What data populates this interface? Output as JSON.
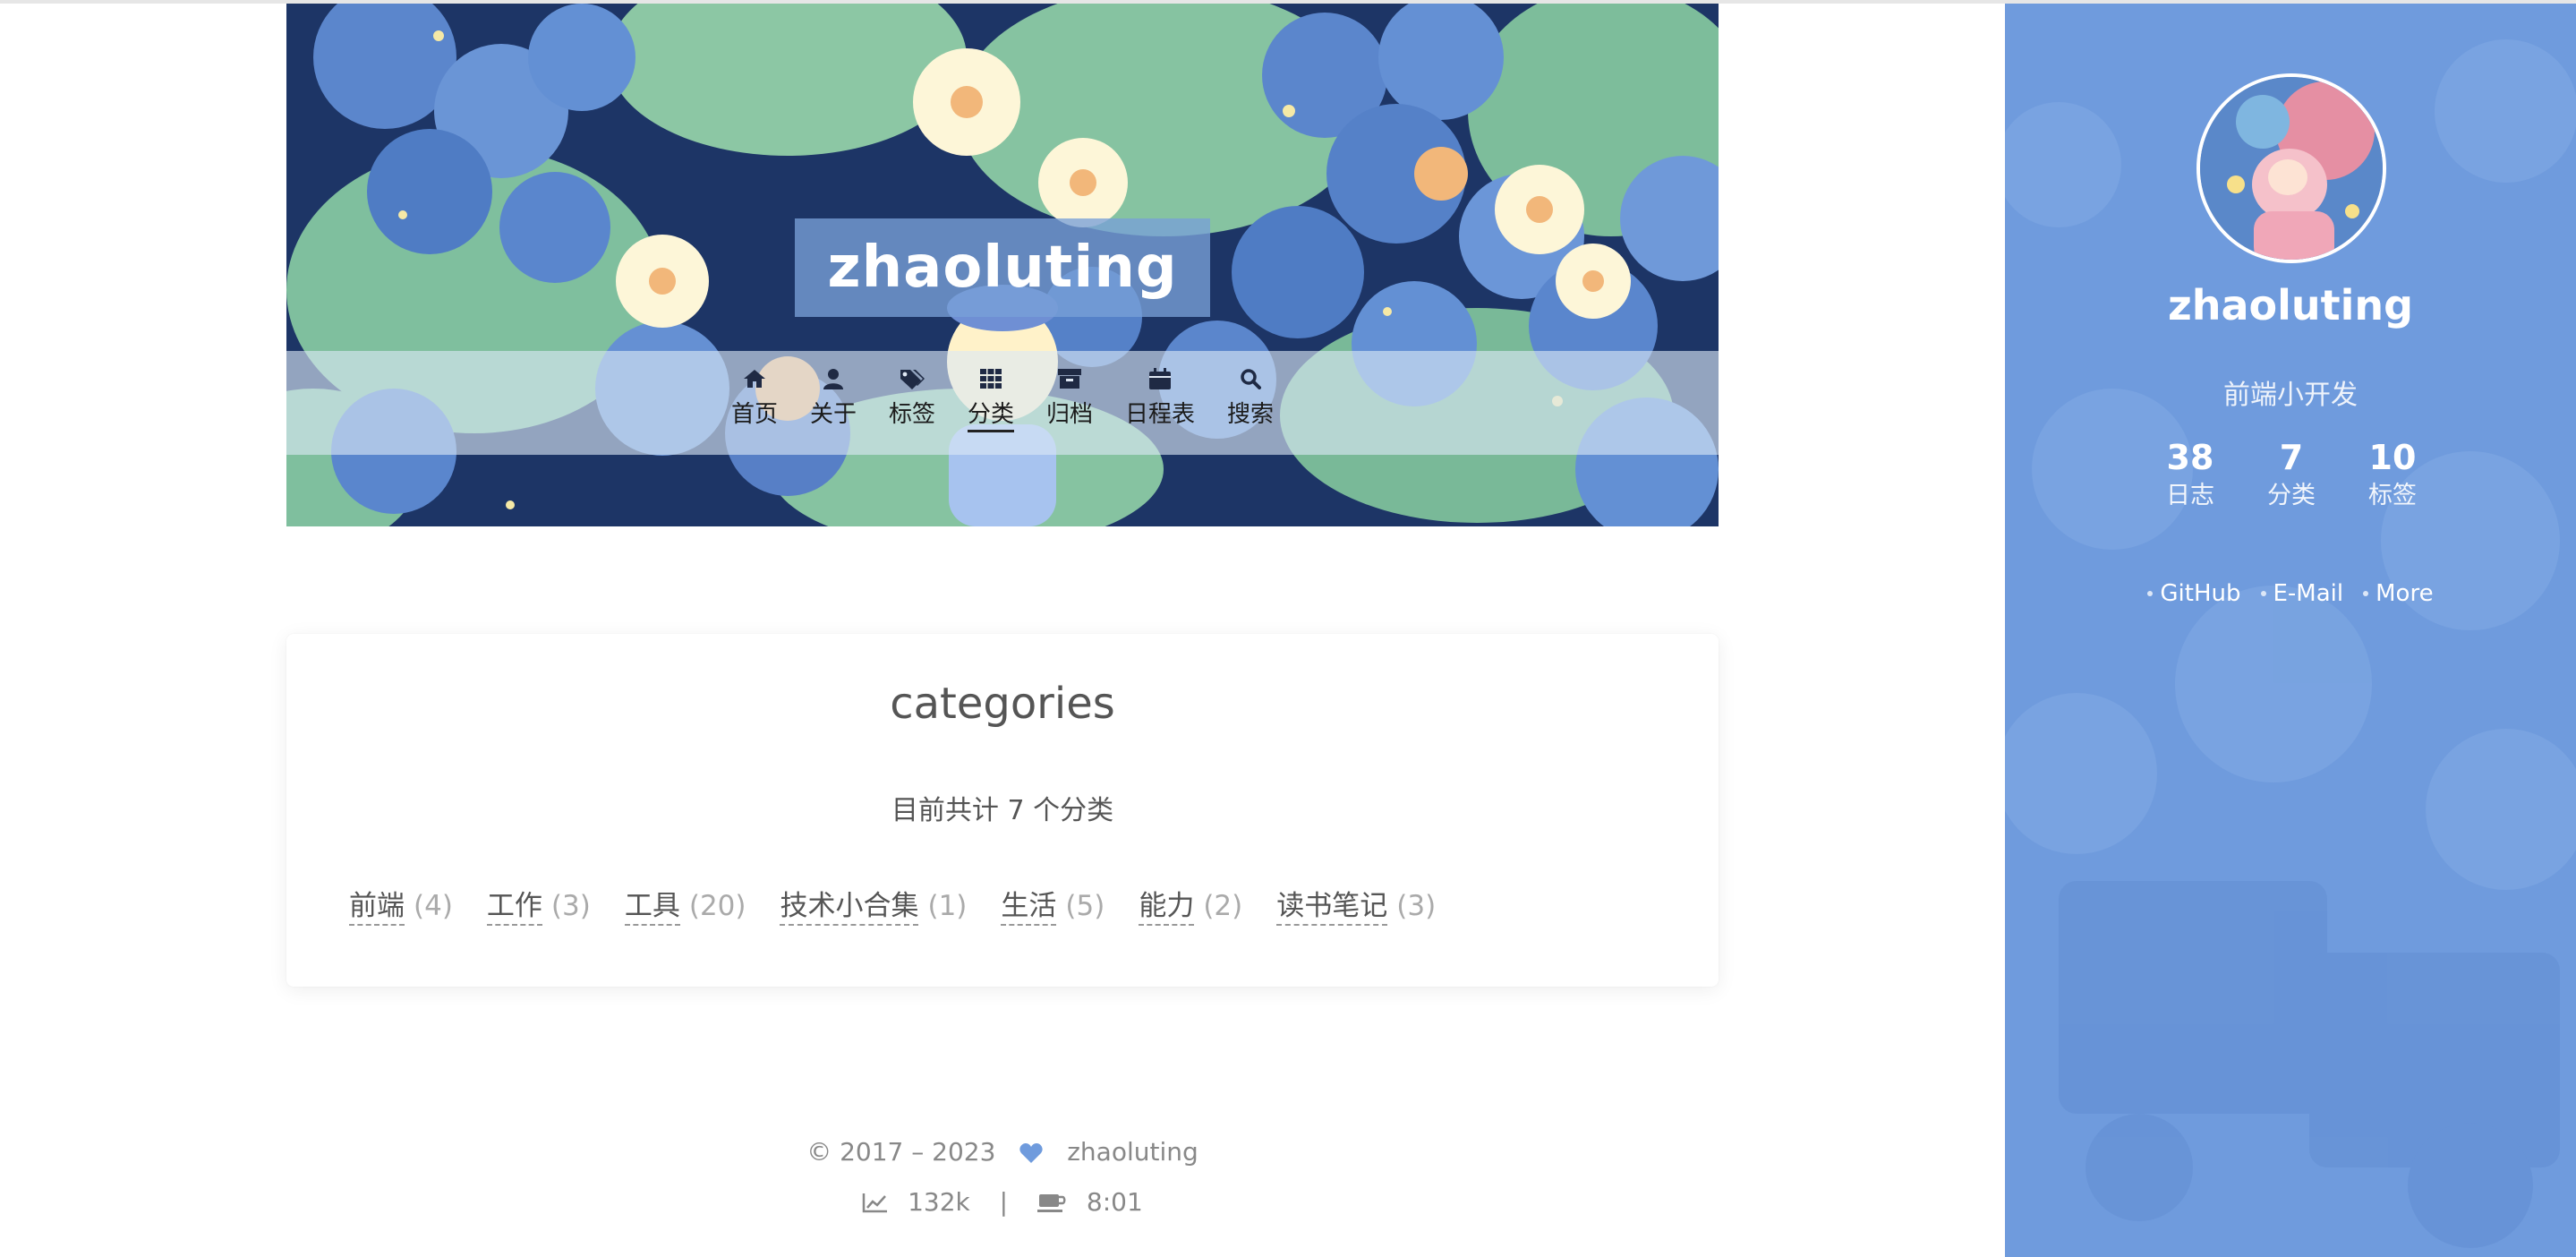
{
  "site": {
    "title": "zhaoluting"
  },
  "menu": [
    {
      "label": "首页",
      "icon": "home-icon"
    },
    {
      "label": "关于",
      "icon": "user-icon"
    },
    {
      "label": "标签",
      "icon": "tags-icon"
    },
    {
      "label": "分类",
      "icon": "th-icon",
      "active": true
    },
    {
      "label": "归档",
      "icon": "archive-icon"
    },
    {
      "label": "日程表",
      "icon": "calendar-icon"
    },
    {
      "label": "搜索",
      "icon": "search-icon"
    }
  ],
  "page": {
    "title": "categories",
    "count_text": "目前共计 7 个分类",
    "categories": [
      {
        "name": "前端",
        "count": "(4)"
      },
      {
        "name": "工作",
        "count": "(3)"
      },
      {
        "name": "工具",
        "count": "(20)"
      },
      {
        "name": "技术小合集",
        "count": "(1)"
      },
      {
        "name": "生活",
        "count": "(5)"
      },
      {
        "name": "能力",
        "count": "(2)"
      },
      {
        "name": "读书笔记",
        "count": "(3)"
      }
    ]
  },
  "footer": {
    "copyright": "© 2017 – 2023",
    "author": "zhaoluting",
    "views": "132k",
    "separator": "|",
    "reading_time": "8:01"
  },
  "sidebar": {
    "name": "zhaoluting",
    "description": "前端小开发",
    "stats": [
      {
        "num": "38",
        "label": "日志"
      },
      {
        "num": "7",
        "label": "分类"
      },
      {
        "num": "10",
        "label": "标签"
      }
    ],
    "links": [
      "GitHub",
      "E-Mail",
      "More"
    ]
  },
  "colors": {
    "sidebar_bg": "#6f9bdd",
    "heart": "#6f9bdd",
    "title_box": "#78a0d7"
  }
}
